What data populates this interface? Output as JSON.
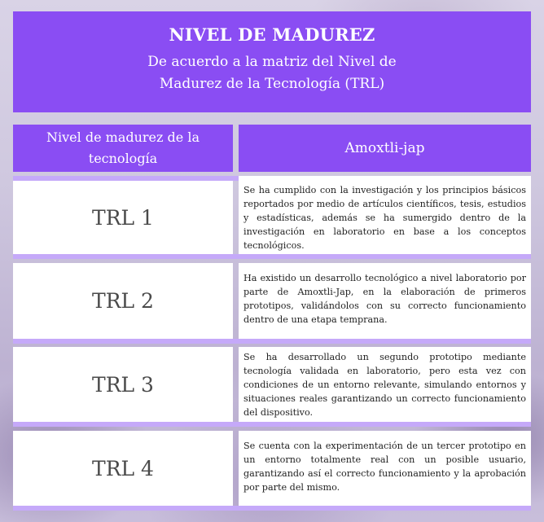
{
  "header": {
    "title": "NIVEL DE MADUREZ",
    "subtitle_line1": "De acuerdo a la matriz del Nivel de",
    "subtitle_line2": "Madurez de la Tecnología (TRL)"
  },
  "columns": {
    "left_line1": "Nivel de madurez de la",
    "left_line2": "tecnología",
    "right": "Amoxtli-jap"
  },
  "rows": [
    {
      "level": "TRL 1",
      "description": "Se ha cumplido con la investigación y los principios básicos reportados por medio de artículos científicos, tesis, estudios y estadísticas, además se ha sumergido dentro de la investigación en laboratorio en base a los conceptos tecnológicos."
    },
    {
      "level": "TRL 2",
      "description": "Ha existido un desarrollo tecnológico a nivel laboratorio por parte de Amoxtli-Jap, en la elaboración de primeros prototipos, validándolos con su correcto funcionamiento dentro de una etapa temprana."
    },
    {
      "level": "TRL 3",
      "description": "Se ha desarrollado un segundo prototipo mediante tecnología validada en laboratorio, pero esta vez con condiciones de un entorno relevante, simulando entornos y situaciones reales garantizando un correcto funcionamiento del dispositivo."
    },
    {
      "level": "TRL 4",
      "description": "Se cuenta con la experimentación de un tercer prototipo en un entorno totalmente real con un posible usuario, garantizando así el correcto funcionamiento y la aprobación por parte del mismo."
    }
  ],
  "colors": {
    "header_purple": "#8a4df3",
    "row_bar_lavender": "#c5a9f9"
  }
}
